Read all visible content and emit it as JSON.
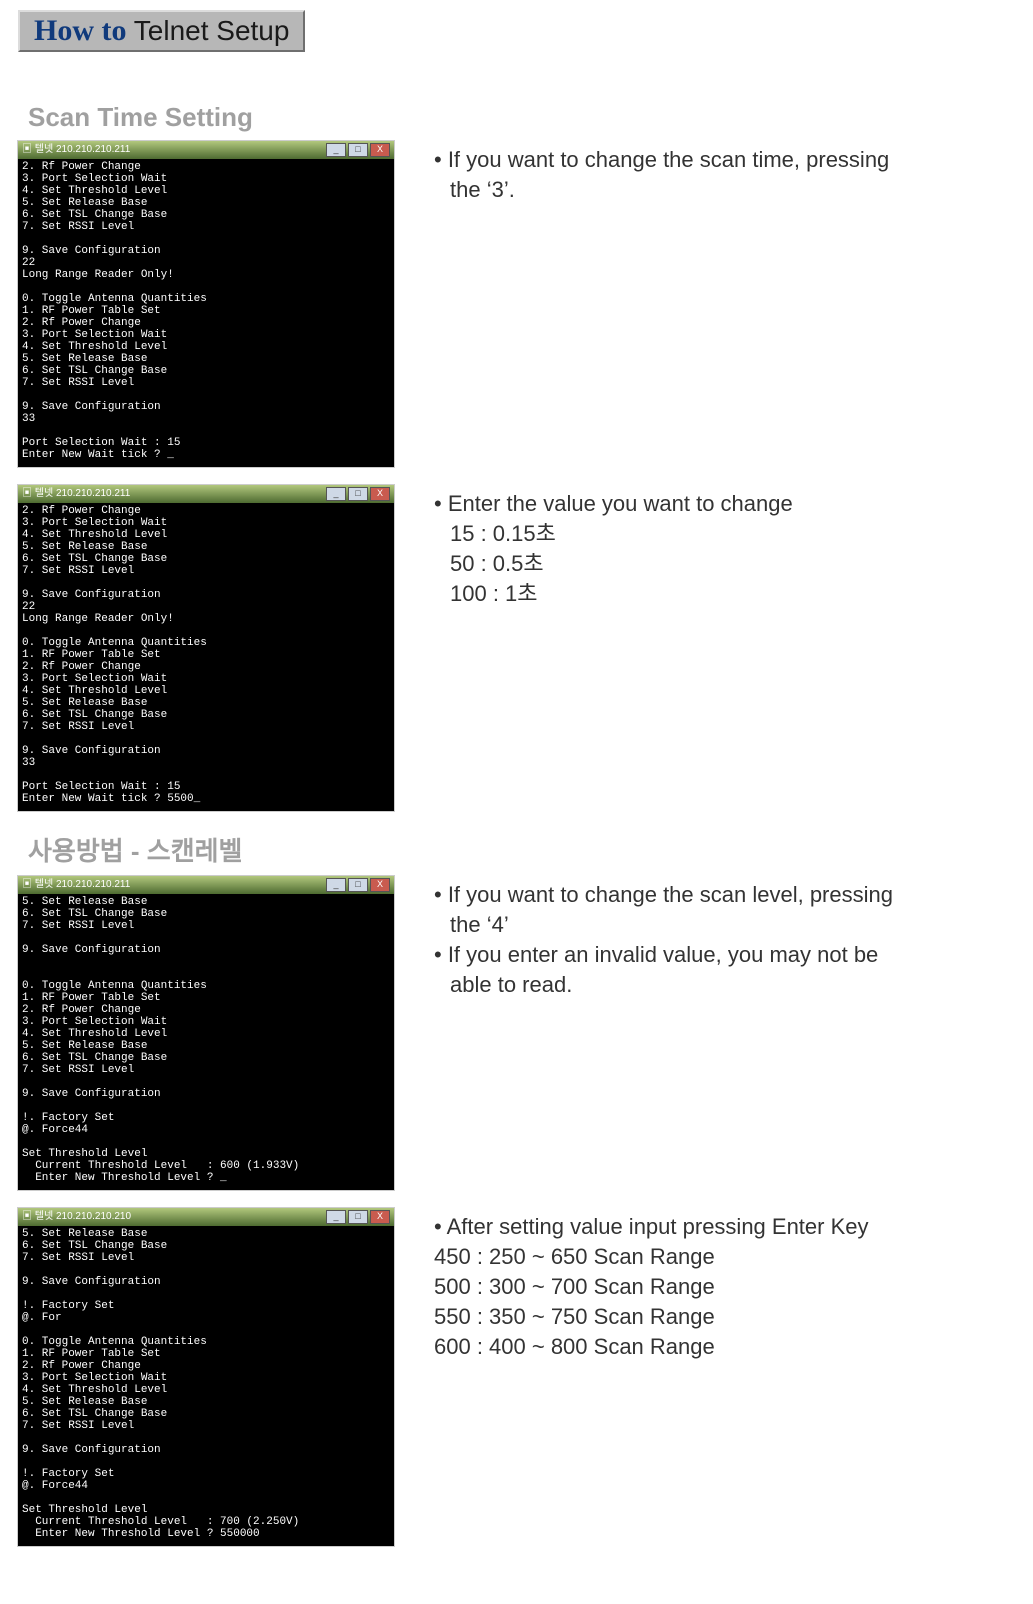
{
  "header": {
    "howto": "How to",
    "title": " Telnet Setup"
  },
  "section1": {
    "title": "Scan Time Setting"
  },
  "section2": {
    "title": "사용방법 - 스캔레벨"
  },
  "telnet1": {
    "titlebar": "▣ 텔넷 210.210.210.211",
    "body": "2. Rf Power Change\n3. Port Selection Wait\n4. Set Threshold Level\n5. Set Release Base\n6. Set TSL Change Base\n7. Set RSSI Level\n\n9. Save Configuration\n22\nLong Range Reader Only!\n\n0. Toggle Antenna Quantities\n1. RF Power Table Set\n2. Rf Power Change\n3. Port Selection Wait\n4. Set Threshold Level\n5. Set Release Base\n6. Set TSL Change Base\n7. Set RSSI Level\n\n9. Save Configuration\n33\n\nPort Selection Wait : 15\nEnter New Wait tick ? _"
  },
  "telnet2": {
    "titlebar": "▣ 텔넷 210.210.210.211",
    "body": "2. Rf Power Change\n3. Port Selection Wait\n4. Set Threshold Level\n5. Set Release Base\n6. Set TSL Change Base\n7. Set RSSI Level\n\n9. Save Configuration\n22\nLong Range Reader Only!\n\n0. Toggle Antenna Quantities\n1. RF Power Table Set\n2. Rf Power Change\n3. Port Selection Wait\n4. Set Threshold Level\n5. Set Release Base\n6. Set TSL Change Base\n7. Set RSSI Level\n\n9. Save Configuration\n33\n\nPort Selection Wait : 15\nEnter New Wait tick ? 5500_"
  },
  "telnet3": {
    "titlebar": "▣ 텔넷 210.210.210.211",
    "body": "5. Set Release Base\n6. Set TSL Change Base\n7. Set RSSI Level\n\n9. Save Configuration\n\n\n0. Toggle Antenna Quantities\n1. RF Power Table Set\n2. Rf Power Change\n3. Port Selection Wait\n4. Set Threshold Level\n5. Set Release Base\n6. Set TSL Change Base\n7. Set RSSI Level\n\n9. Save Configuration\n\n!. Factory Set\n@. Force44\n\nSet Threshold Level\n  Current Threshold Level   : 600 (1.933V)\n  Enter New Threshold Level ? _"
  },
  "telnet4": {
    "titlebar": "▣ 텔넷 210.210.210.210",
    "body": "5. Set Release Base\n6. Set TSL Change Base\n7. Set RSSI Level\n\n9. Save Configuration\n\n!. Factory Set\n@. For\n\n0. Toggle Antenna Quantities\n1. RF Power Table Set\n2. Rf Power Change\n3. Port Selection Wait\n4. Set Threshold Level\n5. Set Release Base\n6. Set TSL Change Base\n7. Set RSSI Level\n\n9. Save Configuration\n\n!. Factory Set\n@. Force44\n\nSet Threshold Level\n  Current Threshold Level   : 700 (2.250V)\n  Enter New Threshold Level ? 550000"
  },
  "desc1": {
    "line1": "• If you want to change the scan time, pressing",
    "line2": "the ‘3’."
  },
  "desc2": {
    "line1": "• Enter the value you want to change",
    "line2": "15 : 0.15초",
    "line3": "50 : 0.5초",
    "line4": "100 : 1초"
  },
  "desc3": {
    "line1": "• If you want to change the scan level, pressing",
    "line2": "the ‘4’",
    "line3": "• If you enter an invalid value, you may not be",
    "line4": "able to read."
  },
  "desc4": {
    "line1": "• After setting value input pressing Enter Key",
    "line2": "450 : 250 ~ 650 Scan Range",
    "line3": "500 : 300 ~ 700 Scan Range",
    "line4": "550 : 350 ~ 750 Scan Range",
    "line5": "600 : 400 ~ 800 Scan Range"
  },
  "winbtn": {
    "min": "_",
    "max": "□",
    "close": "X"
  }
}
